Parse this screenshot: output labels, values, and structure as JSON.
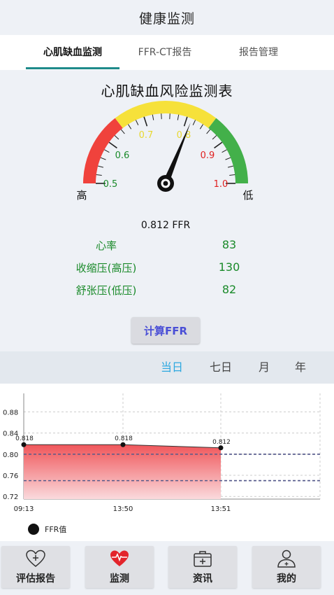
{
  "header": {
    "title": "健康监测"
  },
  "tabs": [
    {
      "label": "心肌缺血监测",
      "active": true
    },
    {
      "label": "FFR-CT报告",
      "active": false
    },
    {
      "label": "报告管理",
      "active": false
    }
  ],
  "monitor": {
    "title": "心肌缺血风险监测表",
    "gauge": {
      "min": 0.5,
      "max": 1.0,
      "value": 0.812,
      "tick_labels": [
        "0.5",
        "0.6",
        "0.7",
        "0.8",
        "0.9",
        "1.0"
      ],
      "high_label": "高",
      "low_label": "低",
      "colors": {
        "red": "#f0423c",
        "yellow": "#f6e13a",
        "green": "#43b04a"
      }
    },
    "ffr_text": "0.812 FFR",
    "vitals": [
      {
        "label": "心率",
        "value": "83"
      },
      {
        "label": "收缩压(高压)",
        "value": "130"
      },
      {
        "label": "舒张压(低压)",
        "value": "82"
      }
    ],
    "calc_button": "计算FFR"
  },
  "range_tabs": [
    {
      "label": "当日",
      "active": true
    },
    {
      "label": "七日",
      "active": false
    },
    {
      "label": "月",
      "active": false
    },
    {
      "label": "年",
      "active": false
    }
  ],
  "chart_data": {
    "type": "area",
    "x": [
      "09:13",
      "13:50",
      "13:51"
    ],
    "series": [
      {
        "name": "FFR值",
        "values": [
          0.818,
          0.818,
          0.812
        ]
      }
    ],
    "data_labels": [
      "0.818",
      "0.818",
      "0.812"
    ],
    "y_ticks": [
      "0.72",
      "0.76",
      "0.80",
      "0.84",
      "0.88"
    ],
    "ylim": [
      0.715,
      0.915
    ],
    "reference_lines": [
      0.8,
      0.75
    ],
    "grid": true,
    "legend": "bottom-left",
    "colors": {
      "fill_top": "#f0565a",
      "fill_bottom": "#fadadd",
      "line": "#333333",
      "reference": "#555a8a"
    }
  },
  "bottom_nav": [
    {
      "label": "评估报告",
      "icon": "heart-plus-icon"
    },
    {
      "label": "监测",
      "icon": "heart-pulse-icon"
    },
    {
      "label": "资讯",
      "icon": "medical-kit-icon"
    },
    {
      "label": "我的",
      "icon": "user-icon"
    }
  ]
}
